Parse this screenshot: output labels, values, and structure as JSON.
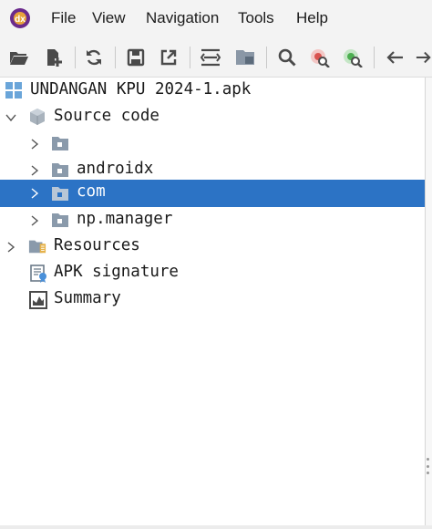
{
  "menu": {
    "items": [
      {
        "label": "File"
      },
      {
        "label": "View"
      },
      {
        "label": "Navigation"
      },
      {
        "label": "Tools"
      },
      {
        "label": "Help"
      }
    ]
  },
  "toolbar": {
    "buttons": [
      "open-file-icon",
      "add-files-icon",
      "sync-icon",
      "save-icon",
      "export-icon",
      "align-icon",
      "project-icon",
      "search-icon",
      "find-class-icon",
      "find-usage-icon",
      "back-arrow-icon",
      "forward-arrow-icon"
    ]
  },
  "tree": {
    "root": "UNDANGAN KPU 2024-1.apk",
    "source_code": "Source code",
    "packages": [
      "",
      "androidx",
      "com",
      "np.manager"
    ],
    "selected_package": "com",
    "resources": "Resources",
    "apk_signature": "APK signature",
    "summary": "Summary"
  },
  "colors": {
    "selection": "#2c73c5",
    "folder": "#7a8ea3",
    "accent_red": "#d9534f",
    "accent_green": "#4caf50"
  }
}
